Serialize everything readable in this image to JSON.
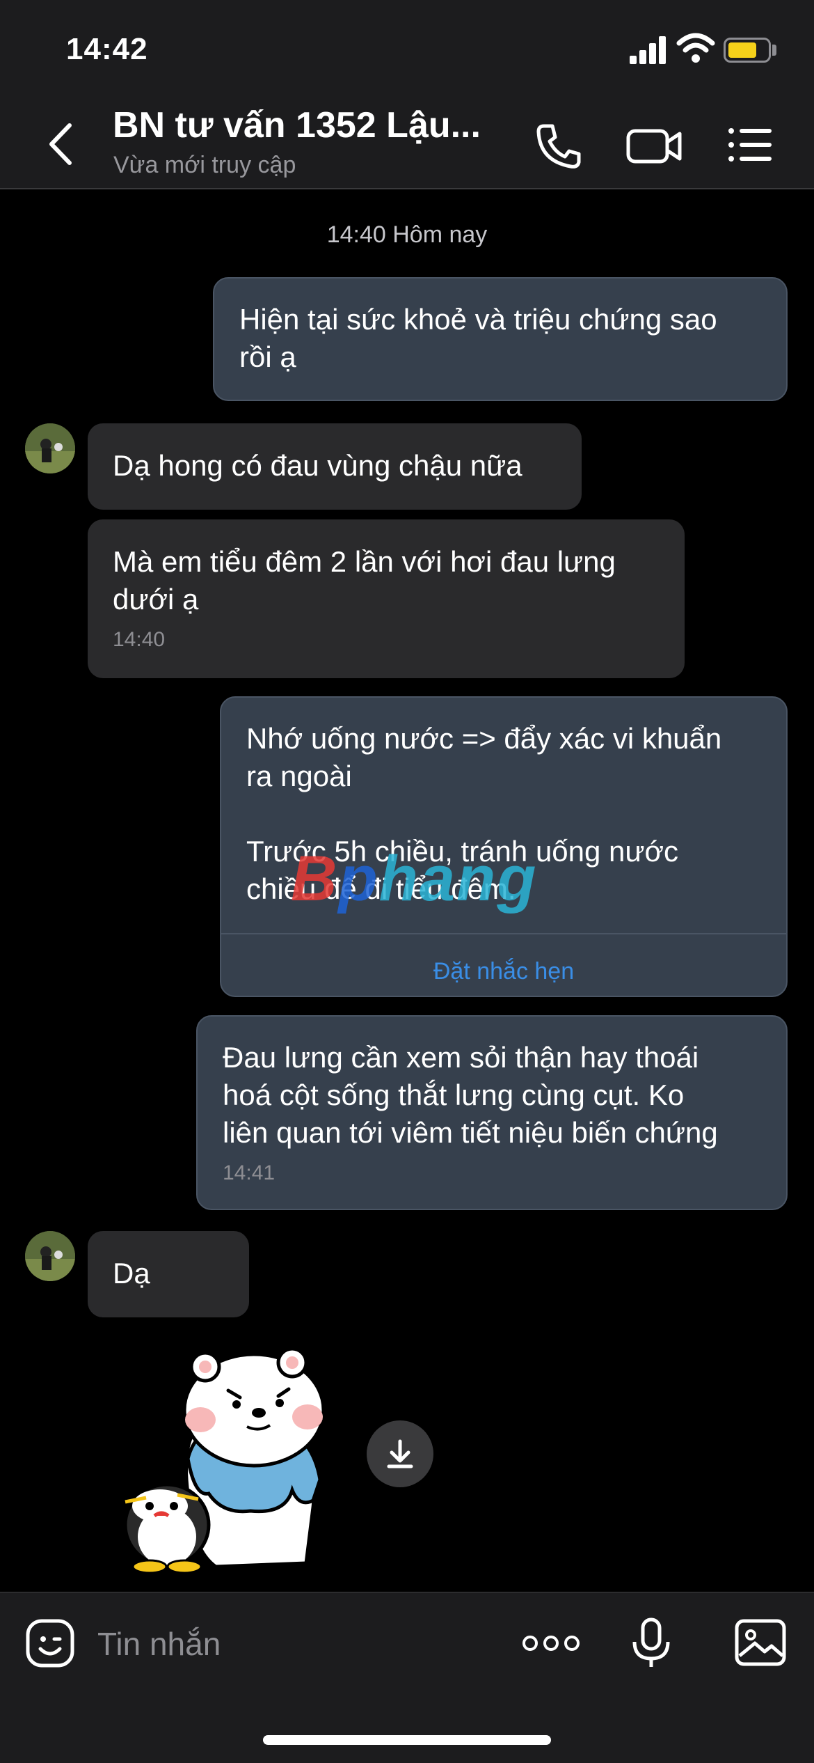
{
  "status_bar": {
    "time": "14:42"
  },
  "header": {
    "title": "BN tư vấn 1352 Lậu...",
    "subtitle": "Vừa mới truy cập"
  },
  "chat": {
    "day_separator": "14:40 Hôm nay",
    "messages": [
      {
        "side": "out",
        "text_lines": [
          "Hiện tại sức khoẻ và triệu chứng sao",
          "rồi ạ"
        ]
      },
      {
        "side": "in",
        "text_lines": [
          "Dạ hong có đau vùng chậu nữa"
        ]
      },
      {
        "side": "in",
        "text_lines": [
          "Mà em tiểu đêm 2 lần với hơi đau lưng",
          "dưới ạ"
        ],
        "time": "14:40"
      },
      {
        "side": "out",
        "text_lines": [
          "Nhớ uống nước => đẩy xác vi khuẩn",
          "ra ngoài",
          "",
          "Trước 5h chiều, tránh uống nước",
          "chiều để đi tiểu đêm."
        ],
        "action": "Đặt nhắc hẹn"
      },
      {
        "side": "out",
        "text_lines": [
          "Đau lưng cần xem sỏi thận hay thoái",
          "hoá cột sống thắt lưng cùng cụt. Ko",
          "liên quan tới viêm tiết niệu biến chứng"
        ],
        "time": "14:41"
      },
      {
        "side": "in",
        "text_lines": [
          "Dạ"
        ]
      }
    ],
    "watermark": {
      "part1": "B",
      "part2": "p",
      "part3": "hang"
    }
  },
  "composer": {
    "placeholder": "Tin nhắn"
  },
  "colors": {
    "outgoing_bubble": "#36404d",
    "incoming_bubble": "#2a2a2c",
    "link": "#3a8ee6",
    "battery": "#f5d11a"
  }
}
